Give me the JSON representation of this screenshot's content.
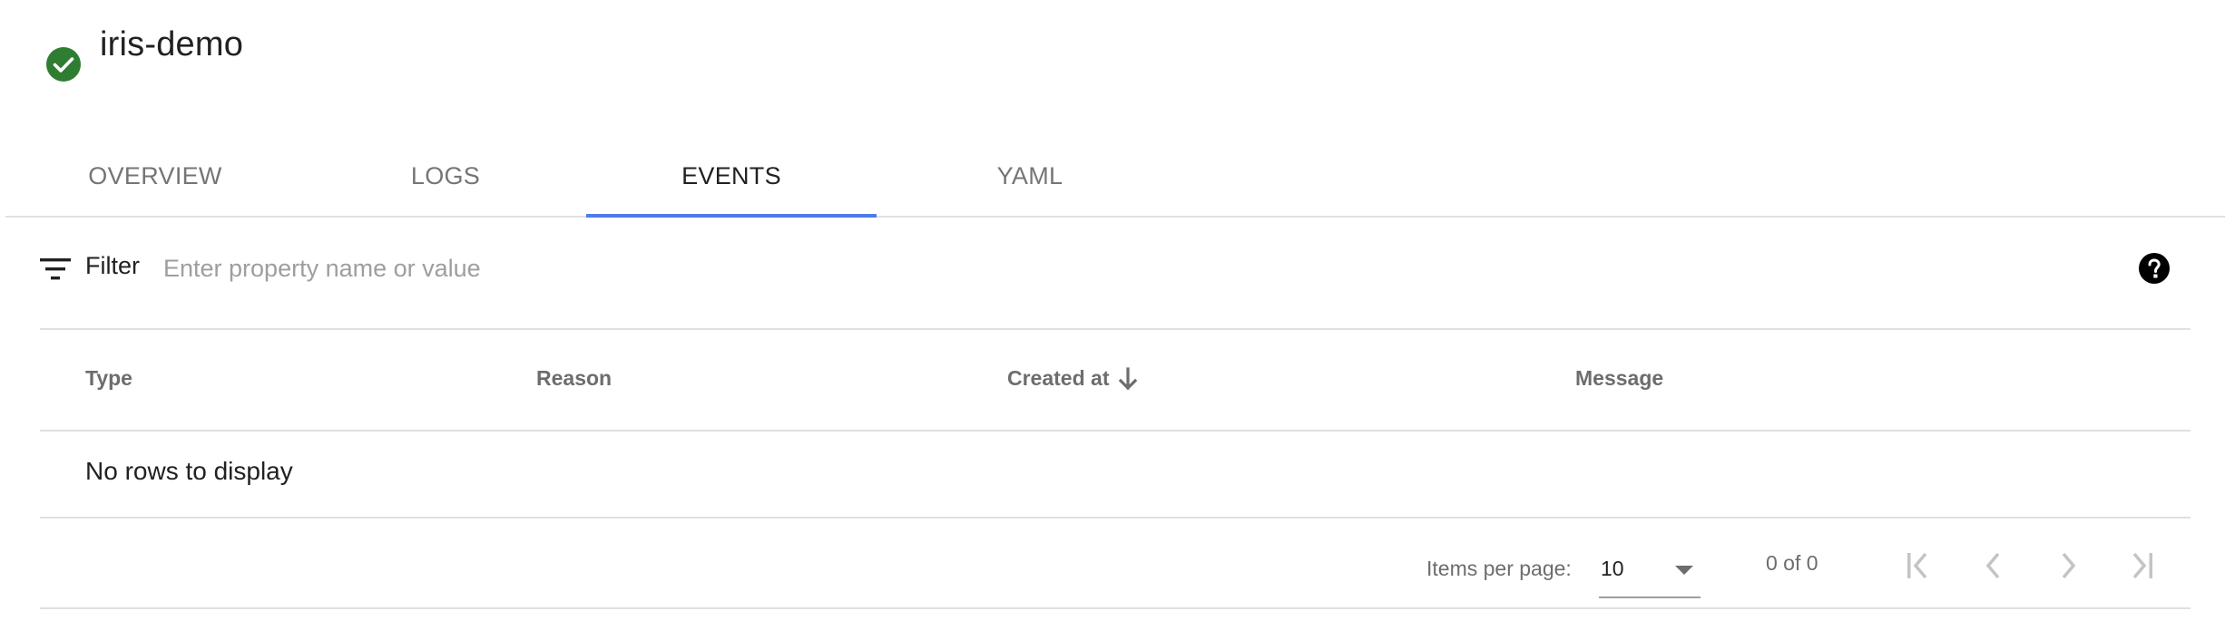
{
  "header": {
    "title": "iris-demo",
    "status": "ready",
    "status_icon": "check-circle-icon",
    "status_color": "#2e7d32"
  },
  "tabs": [
    {
      "label": "OVERVIEW",
      "active": false
    },
    {
      "label": "LOGS",
      "active": false
    },
    {
      "label": "EVENTS",
      "active": true
    },
    {
      "label": "YAML",
      "active": false
    }
  ],
  "accent_color": "#4d7bea",
  "filter": {
    "label": "Filter",
    "icon": "filter-list-icon",
    "placeholder": "Enter property name or value",
    "value": "",
    "help_icon": "help-circle-icon"
  },
  "table": {
    "columns": [
      {
        "label": "Type"
      },
      {
        "label": "Reason"
      },
      {
        "label": "Created at",
        "sorted": "descending",
        "sort_icon": "arrow-down-icon"
      },
      {
        "label": "Message"
      }
    ],
    "rows": [],
    "empty_message": "No rows to display"
  },
  "paginator": {
    "items_per_page_label": "Items per page:",
    "items_per_page": "10",
    "range_label": "0 of 0",
    "buttons": [
      {
        "name": "first-page",
        "icon": "first-page-icon",
        "enabled": false
      },
      {
        "name": "previous-page",
        "icon": "chevron-left-icon",
        "enabled": false
      },
      {
        "name": "next-page",
        "icon": "chevron-right-icon",
        "enabled": false
      },
      {
        "name": "last-page",
        "icon": "last-page-icon",
        "enabled": false
      }
    ]
  }
}
